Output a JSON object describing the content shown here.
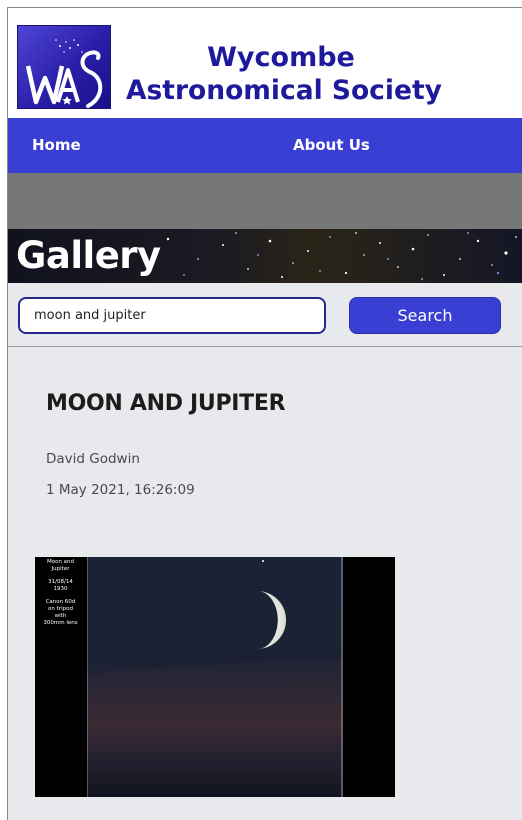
{
  "header": {
    "title_line1": "Wycombe",
    "title_line2": "Astronomical Society",
    "logo_icon": "was-logo-icon",
    "logo_text": "WAS"
  },
  "nav": {
    "items": [
      {
        "label": "Home"
      },
      {
        "label": "About Us"
      }
    ]
  },
  "banner": {
    "title": "Gallery"
  },
  "search": {
    "value": "moon and jupiter",
    "button_label": "Search"
  },
  "post": {
    "title": "MOON AND JUPITER",
    "author": "David Godwin",
    "date": "1 May 2021, 16:26:09"
  },
  "photo": {
    "caption_title_1": "Moon and",
    "caption_title_2": "Jupiter",
    "caption_date": "31/08/14",
    "caption_time": "1930",
    "caption_gear_1": "Canon 60d",
    "caption_gear_2": "on tripod",
    "caption_gear_3": "with",
    "caption_gear_4": "300mm lens"
  },
  "colors": {
    "brand_blue": "#3a3fd4",
    "title_blue": "#1f1a9c",
    "input_border": "#27288e",
    "content_bg": "#e8e9ed"
  }
}
